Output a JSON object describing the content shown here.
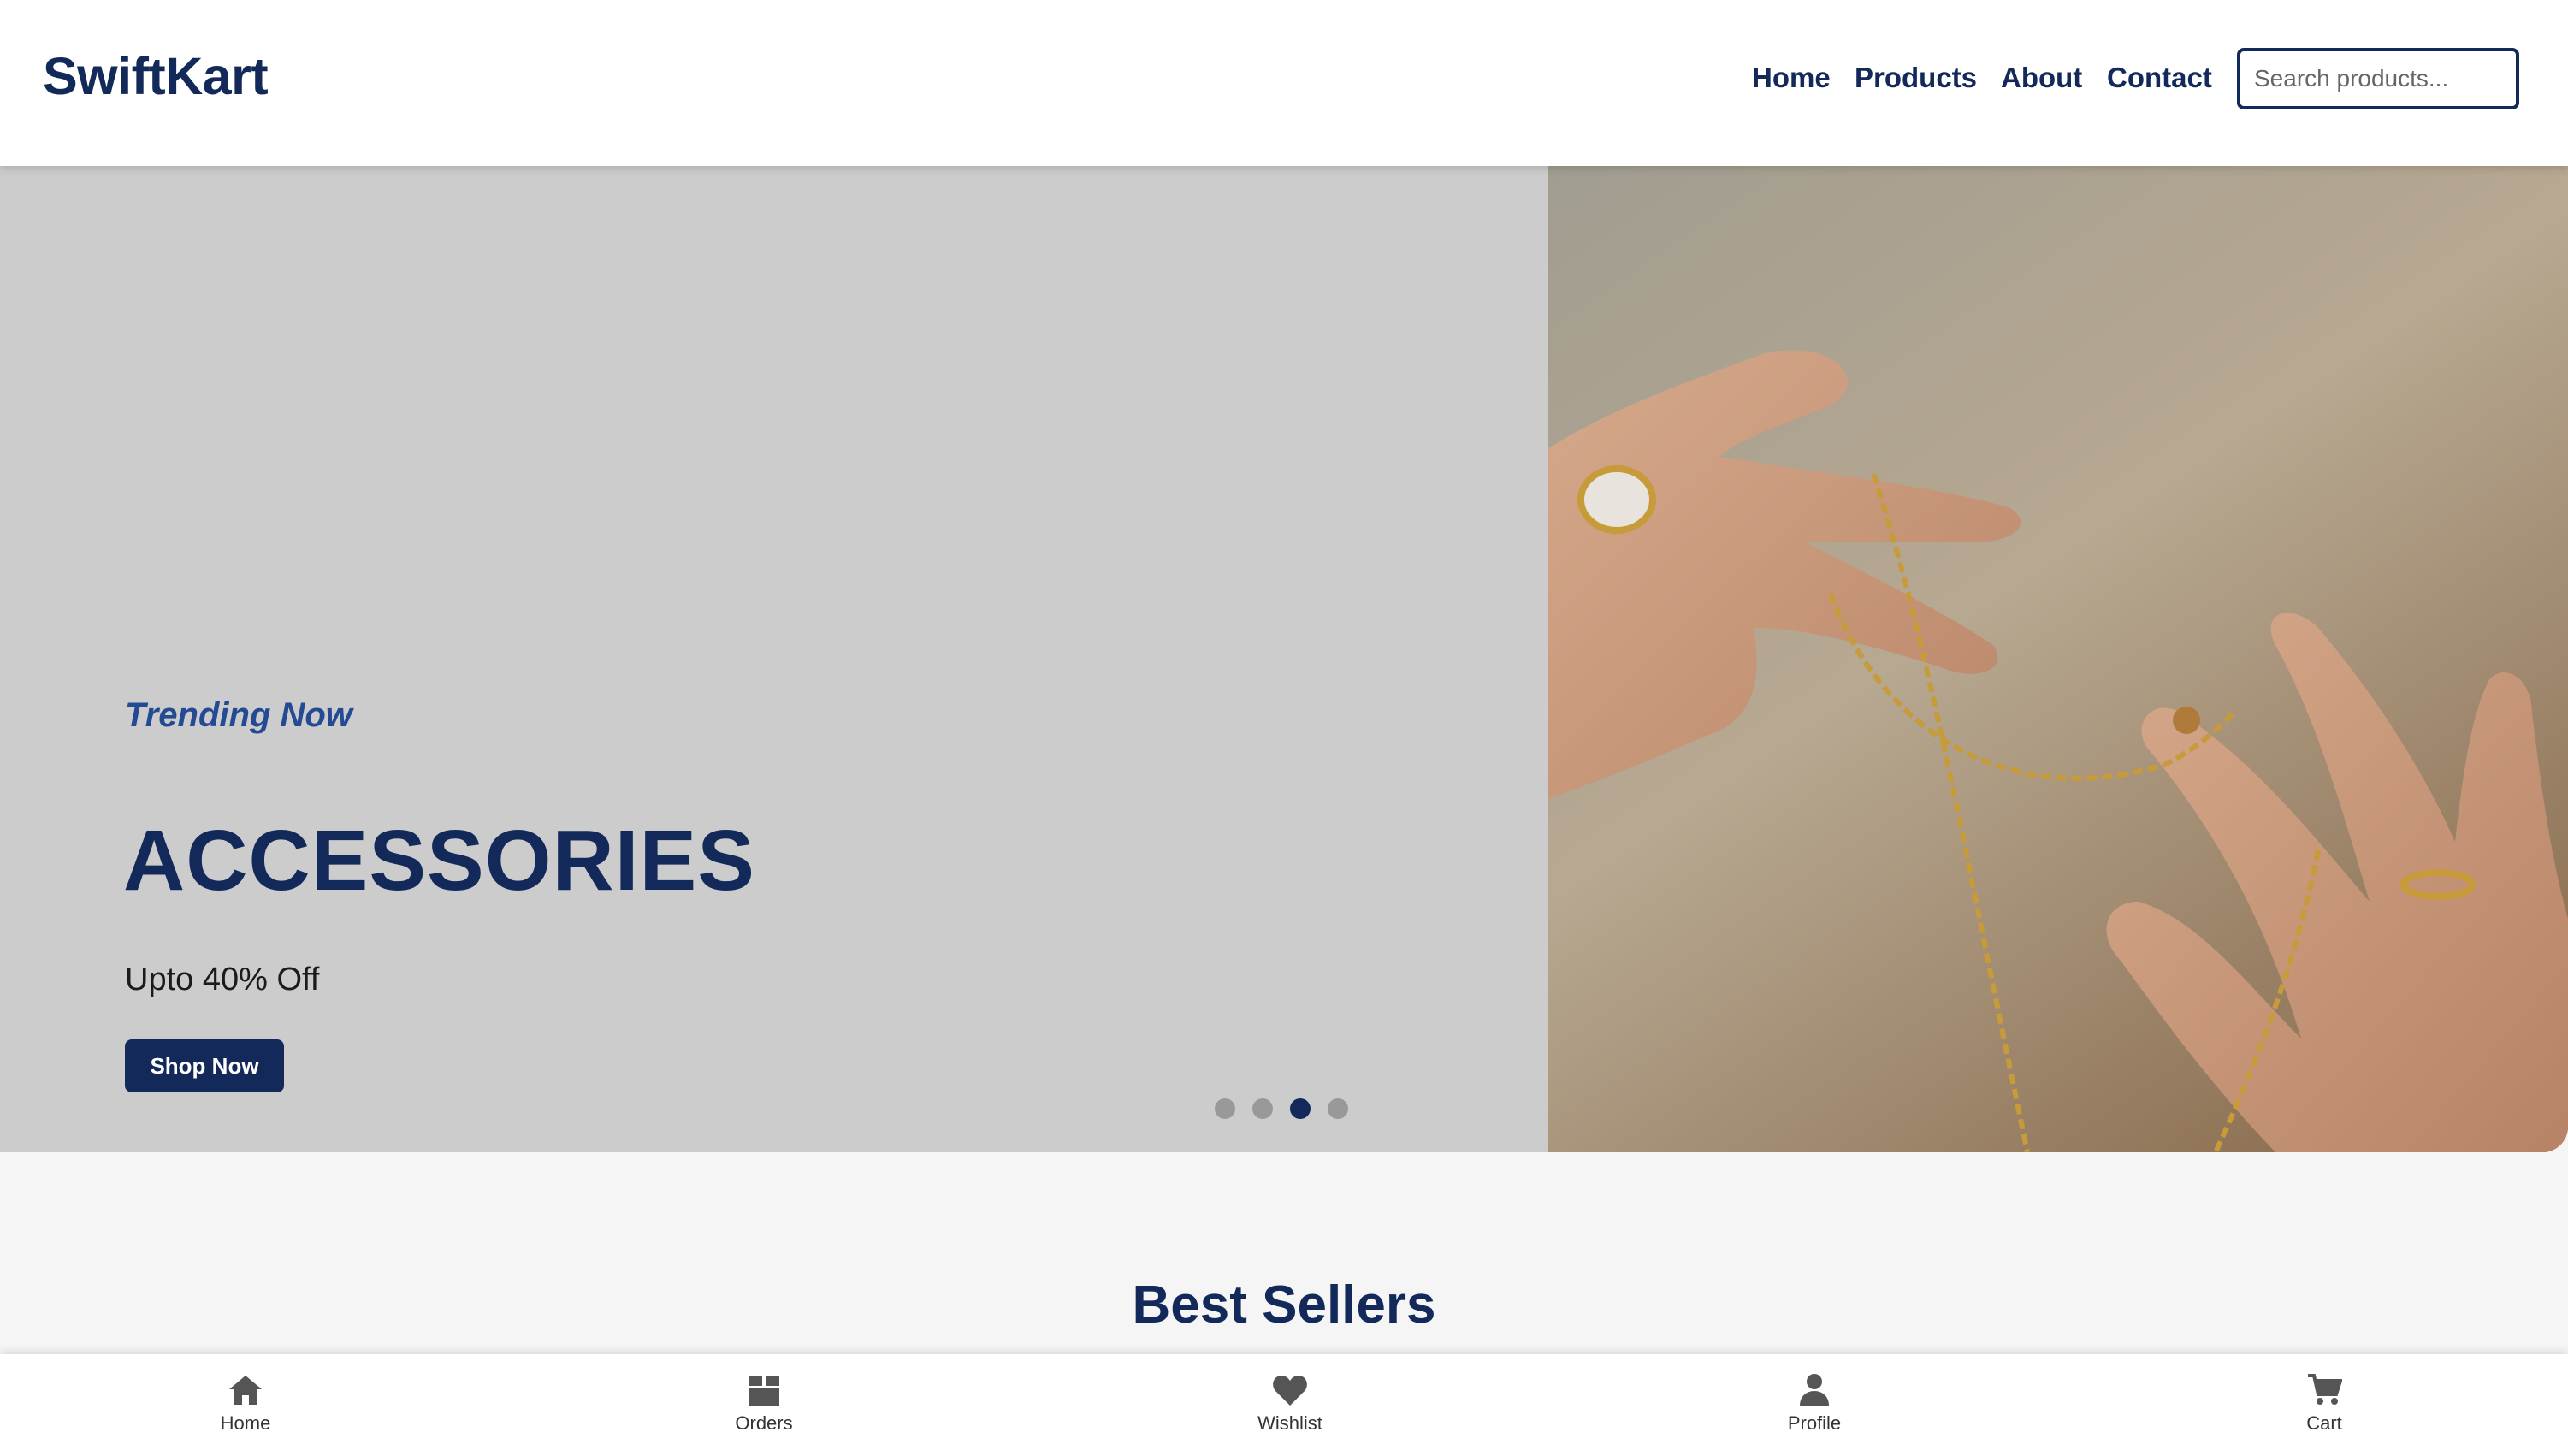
{
  "brand": {
    "logo": "SwiftKart",
    "color_primary": "#12295a",
    "color_accent": "#234a93"
  },
  "nav": {
    "links": [
      "Home",
      "Products",
      "About",
      "Contact"
    ],
    "search_placeholder": "Search products..."
  },
  "hero": {
    "eyebrow": "Trending Now",
    "title": "ACCESSORIES",
    "subtitle": "Upto 40% Off",
    "cta": "Shop Now",
    "image": "hands-with-gold-chain-and-rings",
    "slides_total": 4,
    "active_slide": 3
  },
  "section": {
    "title": "Best Sellers"
  },
  "bottom_nav": {
    "items": [
      {
        "label": "Home",
        "icon": "home-icon"
      },
      {
        "label": "Orders",
        "icon": "box-icon"
      },
      {
        "label": "Wishlist",
        "icon": "heart-icon"
      },
      {
        "label": "Profile",
        "icon": "user-icon"
      },
      {
        "label": "Cart",
        "icon": "cart-icon"
      }
    ]
  }
}
